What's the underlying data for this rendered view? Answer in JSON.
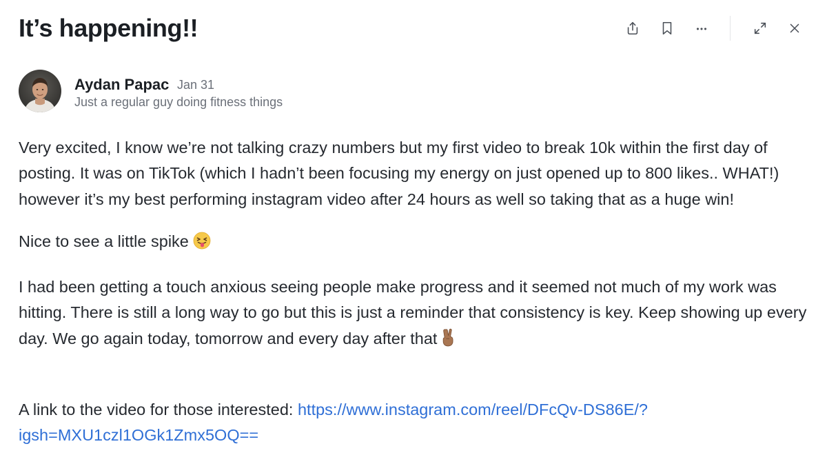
{
  "post": {
    "title": "It’s happening!!",
    "author": {
      "name": "Aydan Papac",
      "date": "Jan 31",
      "bio": "Just a regular guy doing fitness things"
    },
    "paragraphs": {
      "p1": "Very excited, I know we’re not talking crazy numbers but my first video to break 10k within the first day of posting. It was on TikTok (which I hadn’t been focusing my energy on just opened up to 800 likes.. WHAT!) however it’s my best performing instagram video after 24 hours as well so taking that as a huge win!",
      "p2": "Nice to see a little spike",
      "p3": "I had been getting a touch anxious seeing people make progress and it seemed not much of my work was hitting. There is still a long way to go but this is just a reminder that consistency is key. Keep showing up every day. We go again today, tomorrow and every day after that",
      "p4_prefix": "A link to the video for those interested: ",
      "p4_link": "https://www.instagram.com/reel/DFcQv-DS86E/?igsh=MXU1czl1OGk1Zmx5OQ=="
    },
    "emojis": {
      "p2": "squinting-face-with-tongue",
      "p3": "victory-hand"
    }
  },
  "toolbar": {
    "icons": [
      "share-icon",
      "bookmark-icon",
      "more-icon",
      "expand-icon",
      "close-icon"
    ]
  }
}
